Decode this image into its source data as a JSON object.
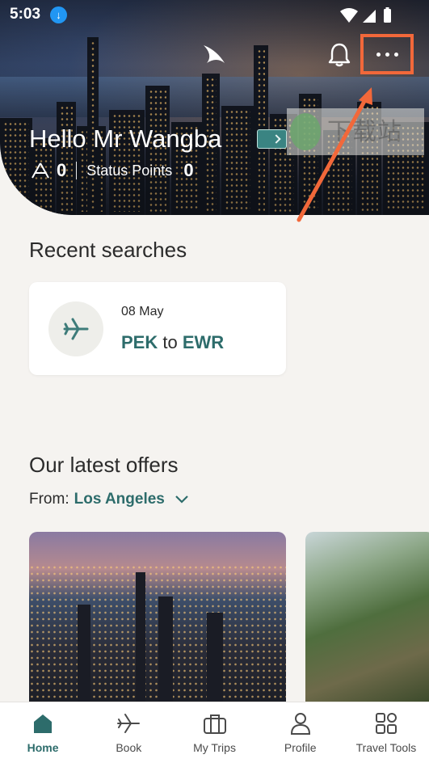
{
  "status_bar": {
    "time": "5:03"
  },
  "header": {
    "greeting": "Hello Mr Wangba",
    "miles_value": "0",
    "status_points_label": "Status Points",
    "status_points_value": "0"
  },
  "watermark": {
    "text": "下载站"
  },
  "recent": {
    "title": "Recent searches",
    "items": [
      {
        "date": "08 May",
        "origin": "PEK",
        "connector": "to",
        "destination": "EWR"
      }
    ]
  },
  "offers": {
    "title": "Our latest offers",
    "from_label": "From:",
    "from_city": "Los Angeles"
  },
  "tabs": [
    {
      "label": "Home",
      "icon": "home-icon",
      "active": true
    },
    {
      "label": "Book",
      "icon": "plane-icon",
      "active": false
    },
    {
      "label": "My Trips",
      "icon": "suitcase-icon",
      "active": false
    },
    {
      "label": "Profile",
      "icon": "person-icon",
      "active": false
    },
    {
      "label": "Travel Tools",
      "icon": "grid-icon",
      "active": false
    }
  ],
  "colors": {
    "accent": "#2d6c6b",
    "highlight_box": "#f2683a",
    "background": "#f5f3f0"
  }
}
